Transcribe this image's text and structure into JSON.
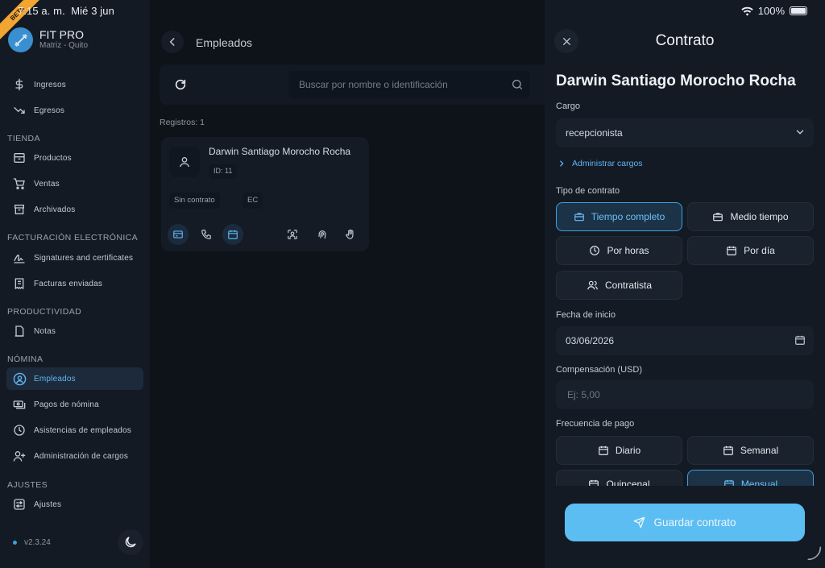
{
  "status": {
    "time": "7:15 a. m.",
    "date": "Mié 3 jun",
    "battery": "100%"
  },
  "beta": "BETA",
  "brand": {
    "title": "FIT PRO",
    "subtitle": "Matriz - Quito"
  },
  "sidebar": {
    "items_top": [
      {
        "label": "Ingresos",
        "icon": "dollar-icon"
      },
      {
        "label": "Egresos",
        "icon": "trend-down-icon"
      }
    ],
    "sections": [
      {
        "title": "TIENDA",
        "items": [
          {
            "label": "Productos",
            "icon": "box-icon"
          },
          {
            "label": "Ventas",
            "icon": "cart-icon"
          },
          {
            "label": "Archivados",
            "icon": "archive-icon"
          }
        ]
      },
      {
        "title": "FACTURACIÓN ELECTRÓNICA",
        "items": [
          {
            "label": "Signatures and certificates",
            "icon": "signature-icon"
          },
          {
            "label": "Facturas enviadas",
            "icon": "receipt-icon"
          }
        ]
      },
      {
        "title": "PRODUCTIVIDAD",
        "items": [
          {
            "label": "Notas",
            "icon": "notes-icon"
          }
        ]
      },
      {
        "title": "NÓMINA",
        "items": [
          {
            "label": "Empleados",
            "icon": "user-circle-icon",
            "active": true
          },
          {
            "label": "Pagos de nómina",
            "icon": "money-icon"
          },
          {
            "label": "Asistencias de empleados",
            "icon": "clock-icon"
          },
          {
            "label": "Administración de cargos",
            "icon": "user-plus-icon"
          }
        ]
      },
      {
        "title": "AJUSTES",
        "items": [
          {
            "label": "Ajustes",
            "icon": "settings-icon"
          }
        ]
      }
    ],
    "version": "v2.3.24"
  },
  "main": {
    "title": "Empleados",
    "search_placeholder": "Buscar por nombre o identificación",
    "records": "Registros: 1",
    "employee": {
      "name": "Darwin Santiago Morocho Rocha",
      "id": "ID: 11",
      "chips": [
        "Sin contrato",
        "EC"
      ]
    }
  },
  "panel": {
    "title": "Contrato",
    "employee_name": "Darwin Santiago Morocho Rocha",
    "cargo_label": "Cargo",
    "cargo_value": "recepcionista",
    "manage_link": "Administrar cargos",
    "tipo_label": "Tipo de contrato",
    "tipos": [
      {
        "label": "Tiempo completo",
        "selected": true
      },
      {
        "label": "Medio tiempo"
      },
      {
        "label": "Por horas"
      },
      {
        "label": "Por día"
      },
      {
        "label": "Contratista"
      }
    ],
    "fecha_label": "Fecha de inicio",
    "fecha_value": "03/06/2026",
    "comp_label": "Compensación (USD)",
    "comp_placeholder": "Ej: 5,00",
    "freq_label": "Frecuencia de pago",
    "frecuencias": [
      {
        "label": "Diario"
      },
      {
        "label": "Semanal"
      },
      {
        "label": "Quincenal"
      },
      {
        "label": "Mensual",
        "selected": true
      }
    ],
    "save_label": "Guardar contrato"
  },
  "colors": {
    "accent": "#5cbdf2",
    "active_text": "#5fb6f0",
    "beta": "#f2a531"
  }
}
